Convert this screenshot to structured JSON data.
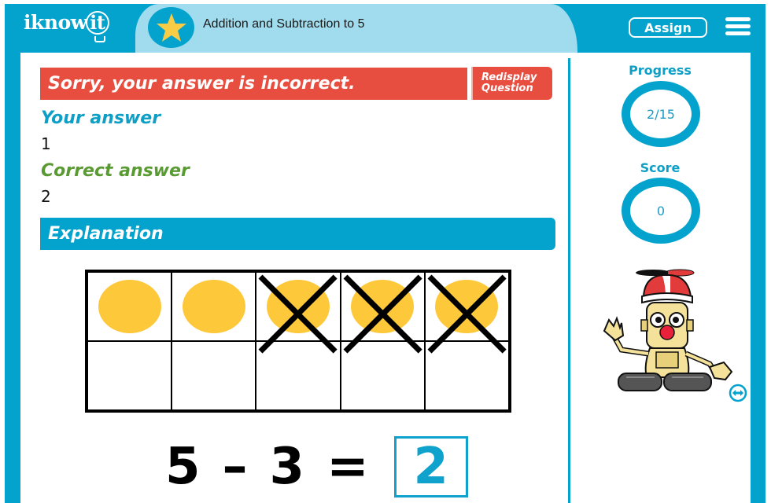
{
  "header": {
    "logo_text": "iknow",
    "logo_bulb_text": "it",
    "lesson_title": "Addition and Subtraction to 5",
    "assign_label": "Assign",
    "menu_icon": "hamburger-menu-icon",
    "badge_icon": "star-icon"
  },
  "feedback": {
    "message": "Sorry, your answer is incorrect.",
    "redisplay_line1": "Redisplay",
    "redisplay_line2": "Question",
    "your_answer_label": "Your answer",
    "your_answer_value": "1",
    "correct_answer_label": "Correct answer",
    "correct_answer_value": "2"
  },
  "explanation": {
    "title": "Explanation",
    "ten_frame": {
      "counters_total": 5,
      "counters_crossed": 3,
      "rows": 2,
      "columns": 5
    },
    "equation": {
      "left": "5",
      "operator": "–",
      "right": "3",
      "equals": "=",
      "answer": "2"
    }
  },
  "sidebar": {
    "progress_label": "Progress",
    "progress_value": "2/15",
    "score_label": "Score",
    "score_value": "0",
    "mascot": "robot-mascot",
    "expand_icon": "expand-arrows-icon"
  },
  "colors": {
    "brand_blue": "#03a3cd",
    "light_blue": "#a0dced",
    "error_red": "#e84e40",
    "correct_green": "#5a9a32",
    "counter_yellow": "#fdc83a"
  }
}
